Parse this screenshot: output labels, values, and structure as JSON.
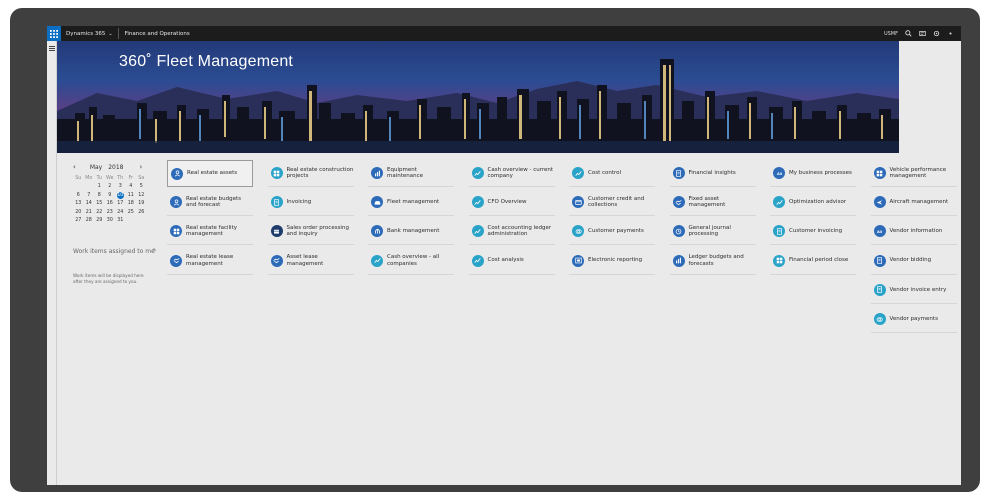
{
  "topbar": {
    "brand": "Dynamics 365",
    "app_name": "Finance and Operations",
    "company": "USMF"
  },
  "banner": {
    "title": "360˚ Fleet Management"
  },
  "calendar": {
    "month": "May",
    "year": "2018",
    "weekdays": [
      "Su",
      "Mo",
      "Tu",
      "We",
      "Th",
      "Fr",
      "Sa"
    ],
    "weeks": [
      [
        "",
        "",
        "1",
        "2",
        "3",
        "4",
        "5"
      ],
      [
        "6",
        "7",
        "8",
        "9",
        "10",
        "11",
        "12"
      ],
      [
        "13",
        "14",
        "15",
        "16",
        "17",
        "18",
        "19"
      ],
      [
        "20",
        "21",
        "22",
        "23",
        "24",
        "25",
        "26"
      ],
      [
        "27",
        "28",
        "29",
        "30",
        "31",
        "",
        ""
      ]
    ],
    "today": "10"
  },
  "work_items": {
    "title": "Work items assigned to me",
    "empty_message": "Work items will be displayed here after they are assigned to you."
  },
  "tiles": [
    {
      "label": "Real estate assets",
      "color": "#2d6bb9",
      "icon": "person-icon",
      "col": 0,
      "row": 0,
      "active": true
    },
    {
      "label": "Real estate budgets and forecast",
      "color": "#2d6bb9",
      "icon": "person-icon",
      "col": 0,
      "row": 1
    },
    {
      "label": "Real estate facility management",
      "color": "#2d6bb9",
      "icon": "grid-icon",
      "col": 0,
      "row": 2
    },
    {
      "label": "Real estate lease management",
      "color": "#2d6bb9",
      "icon": "handshake-icon",
      "col": 0,
      "row": 3
    },
    {
      "label": "Real estate construction projects",
      "color": "#2aa3c9",
      "icon": "grid-icon",
      "col": 1,
      "row": 0
    },
    {
      "label": "Invoicing",
      "color": "#2aa3c9",
      "icon": "document-icon",
      "col": 1,
      "row": 1
    },
    {
      "label": "Sales order processing and inquiry",
      "color": "#1f3b6b",
      "icon": "box-icon",
      "col": 1,
      "row": 2
    },
    {
      "label": "Asset lease management",
      "color": "#2d6bb9",
      "icon": "handshake-icon",
      "col": 1,
      "row": 3
    },
    {
      "label": "Equipment maintenance",
      "color": "#2d6bb9",
      "icon": "chart-icon",
      "col": 2,
      "row": 0
    },
    {
      "label": "Fleet management",
      "color": "#2d6bb9",
      "icon": "car-icon",
      "col": 2,
      "row": 1
    },
    {
      "label": "Bank management",
      "color": "#2d6bb9",
      "icon": "bank-icon",
      "col": 2,
      "row": 2
    },
    {
      "label": "Cash overview - all companies",
      "color": "#2aa3c9",
      "icon": "trend-icon",
      "col": 2,
      "row": 3
    },
    {
      "label": "Cash overview - current company",
      "color": "#2aa3c9",
      "icon": "trend-icon",
      "col": 3,
      "row": 0
    },
    {
      "label": "CFO Overview",
      "color": "#2aa3c9",
      "icon": "trend-icon",
      "col": 3,
      "row": 1
    },
    {
      "label": "Cost accounting ledger administration",
      "color": "#2aa3c9",
      "icon": "trend-icon",
      "col": 3,
      "row": 2
    },
    {
      "label": "Cost analysis",
      "color": "#2aa3c9",
      "icon": "trend-icon",
      "col": 3,
      "row": 3
    },
    {
      "label": "Cost control",
      "color": "#2aa3c9",
      "icon": "trend-icon",
      "col": 4,
      "row": 0
    },
    {
      "label": "Customer credit and collections",
      "color": "#2d6bb9",
      "icon": "card-icon",
      "col": 4,
      "row": 1
    },
    {
      "label": "Customer payments",
      "color": "#2aa3c9",
      "icon": "coins-icon",
      "col": 4,
      "row": 2
    },
    {
      "label": "Electronic reporting",
      "color": "#2d6bb9",
      "icon": "report-icon",
      "col": 4,
      "row": 3
    },
    {
      "label": "Financial insights",
      "color": "#2d6bb9",
      "icon": "document-icon",
      "col": 5,
      "row": 0
    },
    {
      "label": "Fixed asset management",
      "color": "#2d6bb9",
      "icon": "handshake-icon",
      "col": 5,
      "row": 1
    },
    {
      "label": "General journal processing",
      "color": "#2d6bb9",
      "icon": "journal-icon",
      "col": 5,
      "row": 2
    },
    {
      "label": "Ledger budgets and forecasts",
      "color": "#2d6bb9",
      "icon": "chart-icon",
      "col": 5,
      "row": 3
    },
    {
      "label": "My business processes",
      "color": "#2d6bb9",
      "icon": "all-icon",
      "col": 6,
      "row": 0
    },
    {
      "label": "Optimization advisor",
      "color": "#2aa3c9",
      "icon": "trend-icon",
      "col": 6,
      "row": 1
    },
    {
      "label": "Customer invoicing",
      "color": "#2aa3c9",
      "icon": "document-icon",
      "col": 6,
      "row": 2
    },
    {
      "label": "Financial period close",
      "color": "#2aa3c9",
      "icon": "grid-icon",
      "col": 6,
      "row": 3
    },
    {
      "label": "Vehicle performance management",
      "color": "#2d6bb9",
      "icon": "grid-icon",
      "col": 7,
      "row": 0
    },
    {
      "label": "Aircraft management",
      "color": "#2d6bb9",
      "icon": "plane-icon",
      "col": 7,
      "row": 1
    },
    {
      "label": "Vendor information",
      "color": "#2d6bb9",
      "icon": "all-icon",
      "col": 7,
      "row": 2
    },
    {
      "label": "Vendor bidding",
      "color": "#2d6bb9",
      "icon": "document-icon",
      "col": 7,
      "row": 3
    },
    {
      "label": "Vendor invoice entry",
      "color": "#2aa3c9",
      "icon": "document-icon",
      "col": 7,
      "row": 4
    },
    {
      "label": "Vendor payments",
      "color": "#2aa3c9",
      "icon": "coins-icon",
      "col": 7,
      "row": 5
    }
  ]
}
